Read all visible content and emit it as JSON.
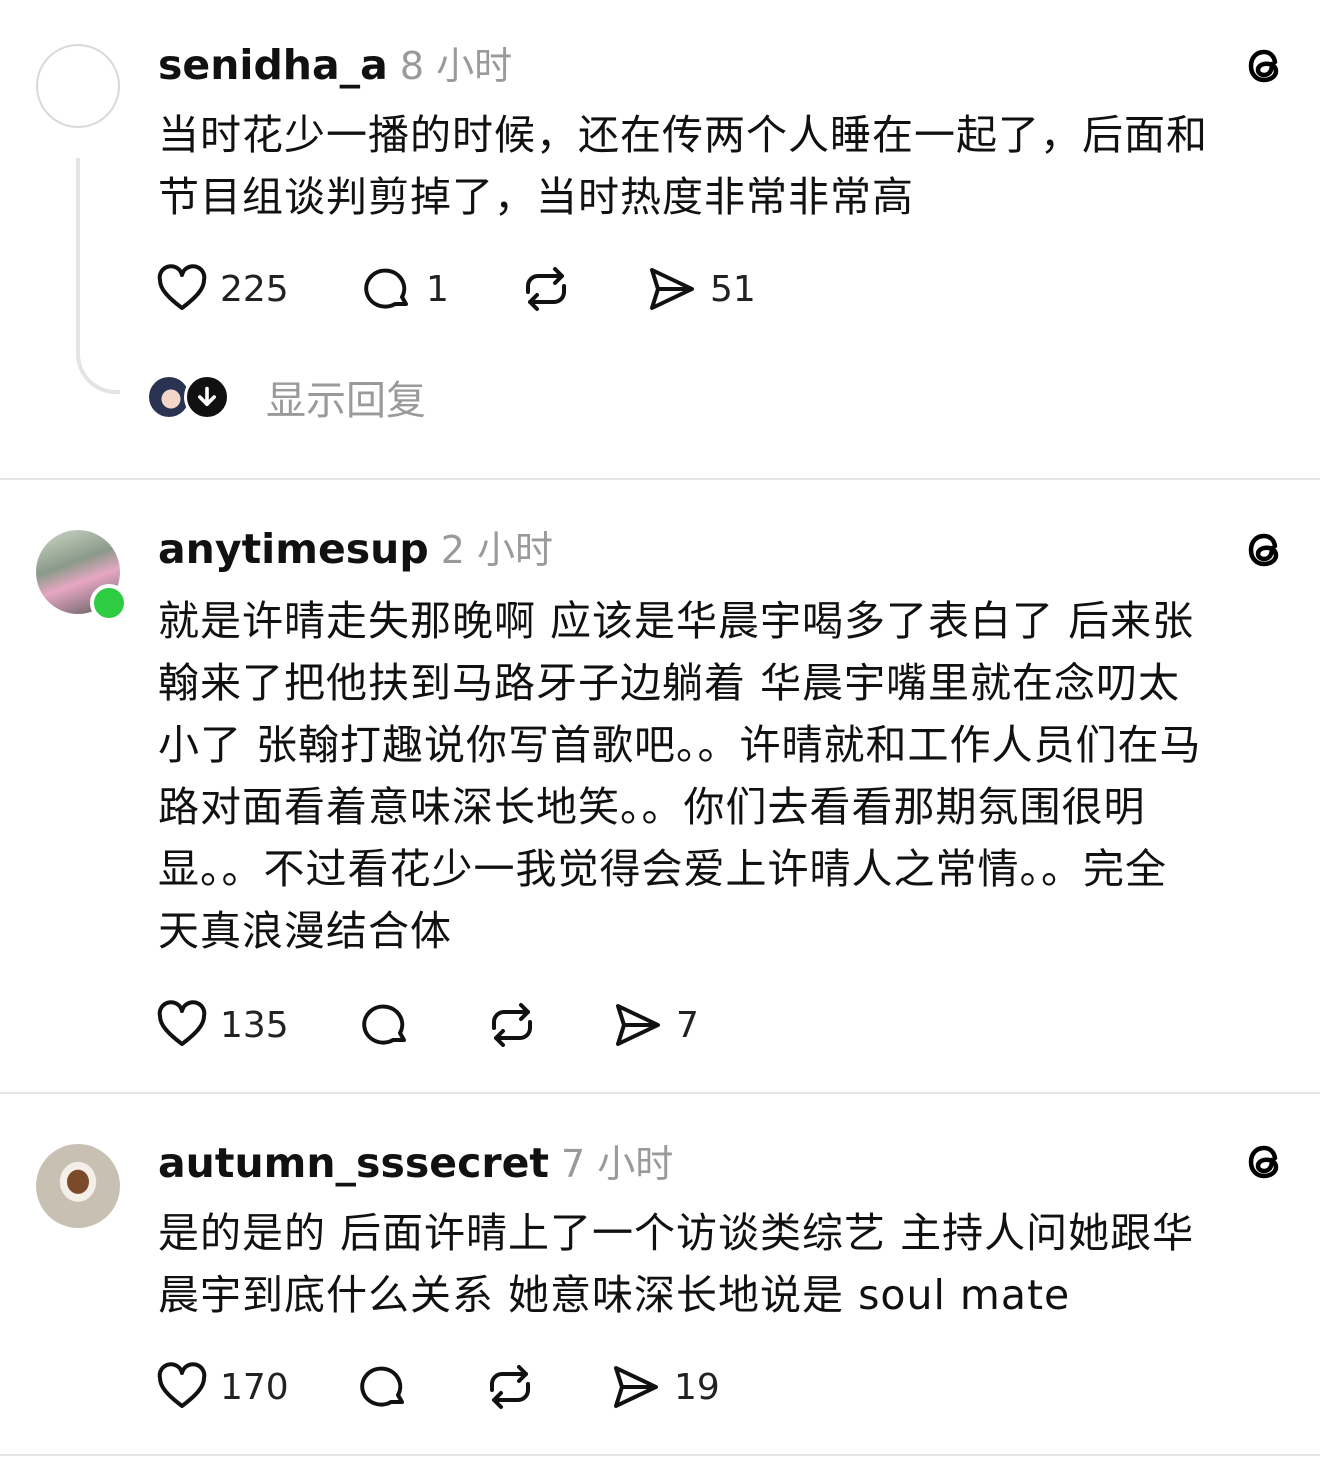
{
  "posts": [
    {
      "username": "senidha_a",
      "time": "8 小时",
      "text_lines": [
        "当时花少一播的时候，还在传两个人睡在一起了，后面和",
        "节目组谈判剪掉了，当时热度非常非常高"
      ],
      "likes": "225",
      "comments": "1",
      "shares": "51",
      "show_replies": "显示回复"
    },
    {
      "username": "anytimesup",
      "time": "2 小时",
      "text_lines": [
        "就是许晴走失那晚啊 应该是华晨宇喝多了表白了 后来张",
        "翰来了把他扶到马路牙子边躺着 华晨宇嘴里就在念叨太",
        "小了 张翰打趣说你写首歌吧。。许晴就和工作人员们在马",
        "路对面看着意味深长地笑。。你们去看看那期氛围很明",
        "显。。不过看花少一我觉得会爱上许晴人之常情。。完全",
        "天真浪漫结合体"
      ],
      "likes": "135",
      "comments": "",
      "shares": "7"
    },
    {
      "username": "autumn_sssecret",
      "time": "7 小时",
      "text_lines": [
        "是的是的 后面许晴上了一个访谈类综艺 主持人问她跟华",
        "晨宇到底什么关系 她意味深长地说是 soul mate"
      ],
      "likes": "170",
      "comments": "",
      "shares": "19"
    }
  ],
  "icons": [
    "threads-logo-icon",
    "heart-icon",
    "comment-icon",
    "repost-icon",
    "share-icon",
    "arrow-down-icon"
  ],
  "colors": {
    "online": "#2ecc40",
    "muted": "#9a9a9a",
    "divider": "#e6e6e6"
  }
}
